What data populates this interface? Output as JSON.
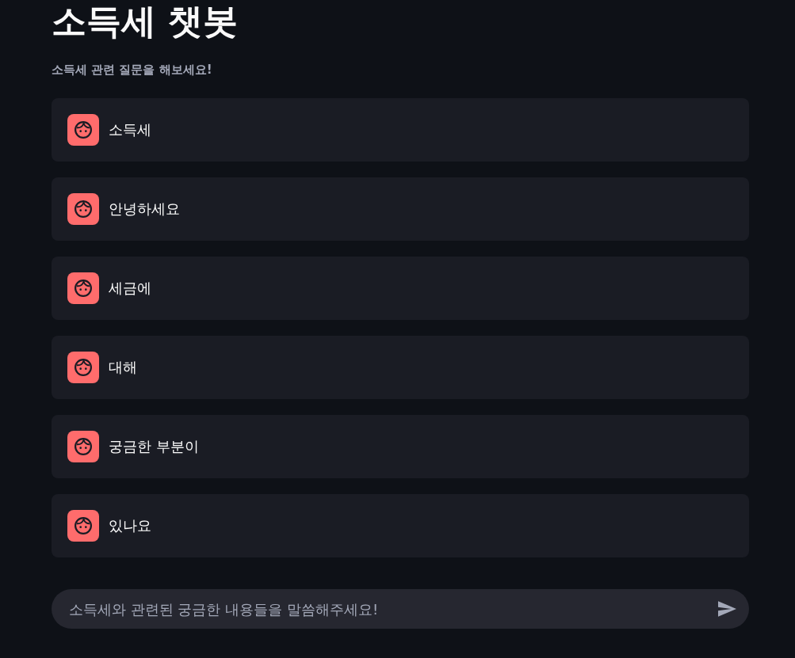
{
  "header": {
    "title": "소득세 챗봇",
    "subtitle": "소득세 관련 질문을 해보세요!"
  },
  "messages": [
    {
      "kind": "user",
      "text": "소득세"
    },
    {
      "kind": "user",
      "text": "안녕하세요"
    },
    {
      "kind": "user",
      "text": "세금에"
    },
    {
      "kind": "user",
      "text": "대해"
    },
    {
      "kind": "user",
      "text": "궁금한 부분이"
    },
    {
      "kind": "user",
      "text": "있나요"
    }
  ],
  "chat_input": {
    "placeholder": "소득세와 관련된 궁금한 내용들을 말씀해주세요!"
  }
}
